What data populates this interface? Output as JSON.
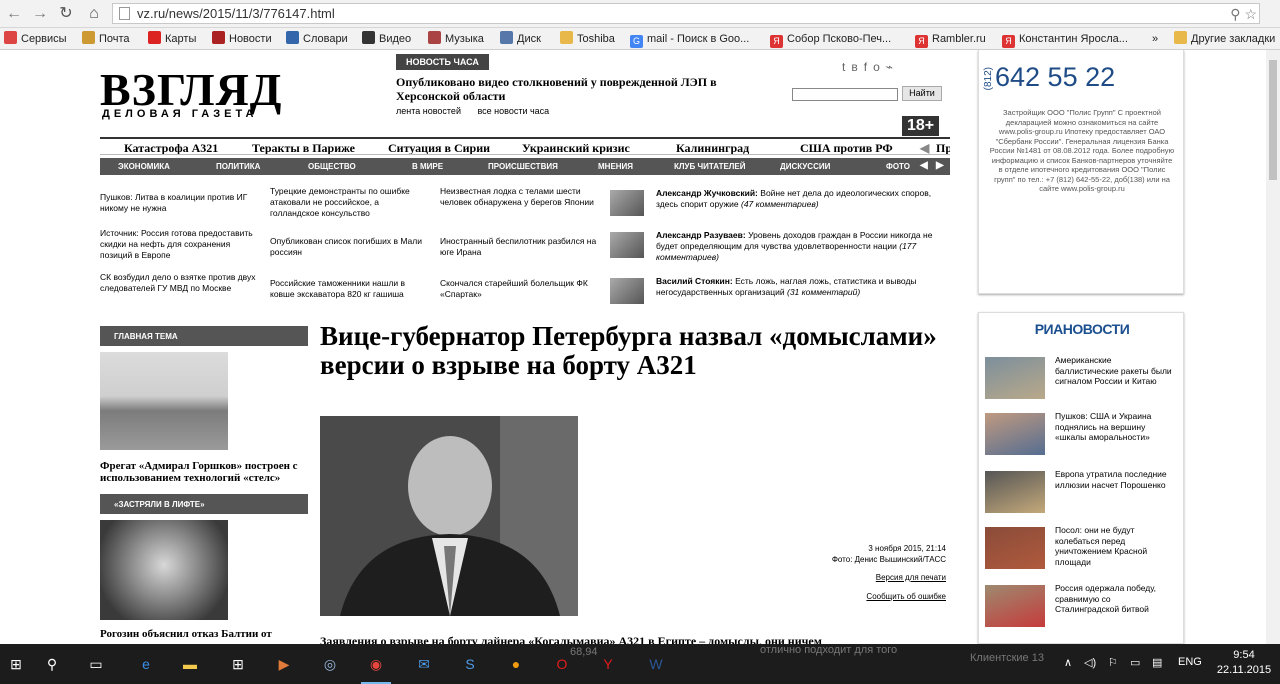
{
  "browser": {
    "url": "vz.ru/news/2015/11/3/776147.html",
    "bookmarks": [
      "Сервисы",
      "Почта",
      "Карты",
      "Новости",
      "Словари",
      "Видео",
      "Музыка",
      "Диск",
      "Toshiba",
      "mail - Поиск в Goo...",
      "Собор Псково-Печ...",
      "Rambler.ru",
      "Константин Яросла...",
      "»",
      "Другие закладки"
    ]
  },
  "site": {
    "logo": "ВЗГЛЯД",
    "logo_sub": "ДЕЛОВАЯ ГАЗЕТА",
    "news_hour_label": "НОВОСТЬ ЧАСА",
    "news_hour_text": "Опубликовано видео столкновений у поврежденной ЛЭП в Херсонской области",
    "news_link1": "лента новостей",
    "news_link2": "все новости часа",
    "search_button": "Найти",
    "age": "18+",
    "topics": [
      "Катастрофа А321",
      "Теракты в Париже",
      "Ситуация в Сирии",
      "Украинский кризис",
      "Калининград",
      "США против РФ",
      "Пр"
    ],
    "rubrics": [
      "ЭКОНОМИКА",
      "ПОЛИТИКА",
      "ОБЩЕСТВО",
      "В МИРЕ",
      "ПРОИСШЕСТВИЯ",
      "МНЕНИЯ",
      "КЛУБ ЧИТАТЕЛЕЙ",
      "ДИСКУССИИ",
      "ФОТО"
    ]
  },
  "teasers": {
    "col1": [
      "Пушков: Литва в коалиции против ИГ никому не нужна",
      "Источник: Россия готова предоставить скидки на нефть для сохранения позиций в Европе",
      "СК возбудил дело о взятке против двух следователей ГУ МВД по Москве"
    ],
    "col2": [
      "Турецкие демонстранты по ошибке атаковали не российское, а голландское консульство",
      "Опубликован список погибших в Мали россиян",
      "Российские таможенники нашли в ковше экскаватора 820 кг гашиша"
    ],
    "col3": [
      "Неизвестная лодка с телами шести человек обнаружена у берегов Японии",
      "Иностранный беспилотник разбился на юге Ирана",
      "Скончался старейший болельщик ФК «Спартак»"
    ]
  },
  "opinions": [
    {
      "author": "Александр Жучковский:",
      "text": "Войне нет дела до идеологических споров, здесь спорит оружие",
      "comments": "(47 комментариев)"
    },
    {
      "author": "Александр Разуваев:",
      "text": "Уровень доходов граждан в России никогда не будет определяющим для чувства удовлетворенности нации",
      "comments": "(177 комментариев)"
    },
    {
      "author": "Василий Стоякин:",
      "text": "Есть ложь, наглая ложь, статистика и выводы негосударственных организаций",
      "comments": "(31 комментарий)"
    }
  ],
  "sidebar": {
    "main_theme_label": "ГЛАВНАЯ ТЕМА",
    "main_theme_caption": "Фрегат «Адмирал Горшков» построен с использованием технологий «стелс»",
    "stuck_label": "«ЗАСТРЯЛИ В ЛИФТЕ»",
    "stuck_caption": "Рогозин объяснил отказ Балтии от"
  },
  "article": {
    "headline": "Вице-губернатор Петербурга назвал «домыслами» версии о взрыве на борту А321",
    "date": "3 ноября 2015, 21:14",
    "photo_credit": "Фото: Денис Вышинский/ТАСС",
    "print_link": "Версия для печати",
    "error_link": "Сообщить об ошибке",
    "lead": "Заявления о взрыве на борту лайнера «Когалымавиа» А321 в Египте – домыслы, они ничем"
  },
  "ad": {
    "phone_prefix": "(812)",
    "phone": "642 55 22",
    "text": "Застройщик ООО \"Полис Групп\" С проектной декларацией можно ознакомиться на сайте www.polis-group.ru Ипотеку предоставляет ОАО \"Сбербанк России\". Генеральная лицензия Банка России №1481 от 08.08.2012 года. Более подробную информацию и список Банков-партнеров уточняйте в отделе ипотечного кредитования ООО \"Полис групп\" по тел.: +7 (812) 642-55-22, доб(138) или на сайте www.polis-group.ru"
  },
  "ria": {
    "logo": "РИАНОВОСТИ",
    "items": [
      "Американские баллистические ракеты были сигналом России и Китаю",
      "Пушков: США и Украина поднялись на вершину «шкалы аморальности»",
      "Европа утратила последние иллюзии насчет Порошенко",
      "Посол: они не будут колебаться перед уничтожением Красной площади",
      "Россия одержала победу, сравнимую со Сталинградской битвой"
    ]
  },
  "overlay": {
    "ghost1": "отлично подходит для того",
    "ghost2": "Клиентские 13",
    "ghost3": "68,94"
  },
  "taskbar": {
    "lang": "ENG",
    "time": "9:54",
    "date": "22.11.2015"
  }
}
